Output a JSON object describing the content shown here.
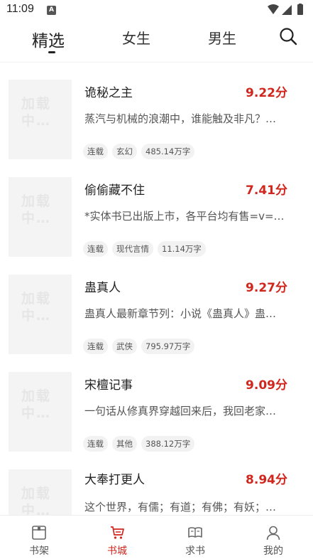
{
  "status_bar": {
    "time": "11:09",
    "notification_letter": "A"
  },
  "tabs": [
    {
      "label": "精选",
      "active": true
    },
    {
      "label": "女生",
      "active": false
    },
    {
      "label": "男生",
      "active": false
    }
  ],
  "cover_placeholder": "加载中…",
  "books": [
    {
      "title": "诡秘之主",
      "score": "9.22分",
      "desc": "蒸汽与机械的浪潮中，谁能触及非凡？…",
      "tags": [
        "连载",
        "玄幻",
        "485.14万字"
      ]
    },
    {
      "title": "偷偷藏不住",
      "score": "7.41分",
      "desc": "*实体书已出版上市，各平台均有售=v=…",
      "tags": [
        "连载",
        "现代言情",
        "11.14万字"
      ]
    },
    {
      "title": "蛊真人",
      "score": "9.27分",
      "desc": "蛊真人最新章节列：小说《蛊真人》蛊…",
      "tags": [
        "连载",
        "武侠",
        "795.97万字"
      ]
    },
    {
      "title": "宋檀记事",
      "score": "9.09分",
      "desc": "一句话从修真界穿越回来后，我回老家…",
      "tags": [
        "连载",
        "其他",
        "388.12万字"
      ]
    },
    {
      "title": "大奉打更人",
      "score": "8.94分",
      "desc": "这个世界，有儒；有道；有佛；有妖；…",
      "tags": []
    }
  ],
  "bottom_nav": [
    {
      "label": "书架",
      "icon": "bookshelf-icon",
      "active": false
    },
    {
      "label": "书城",
      "icon": "cart-icon",
      "active": true
    },
    {
      "label": "求书",
      "icon": "open-book-icon",
      "active": false
    },
    {
      "label": "我的",
      "icon": "person-icon",
      "active": false
    }
  ],
  "colors": {
    "accent": "#d0261d",
    "text": "#222222",
    "tag_bg": "#f2f2f2"
  }
}
